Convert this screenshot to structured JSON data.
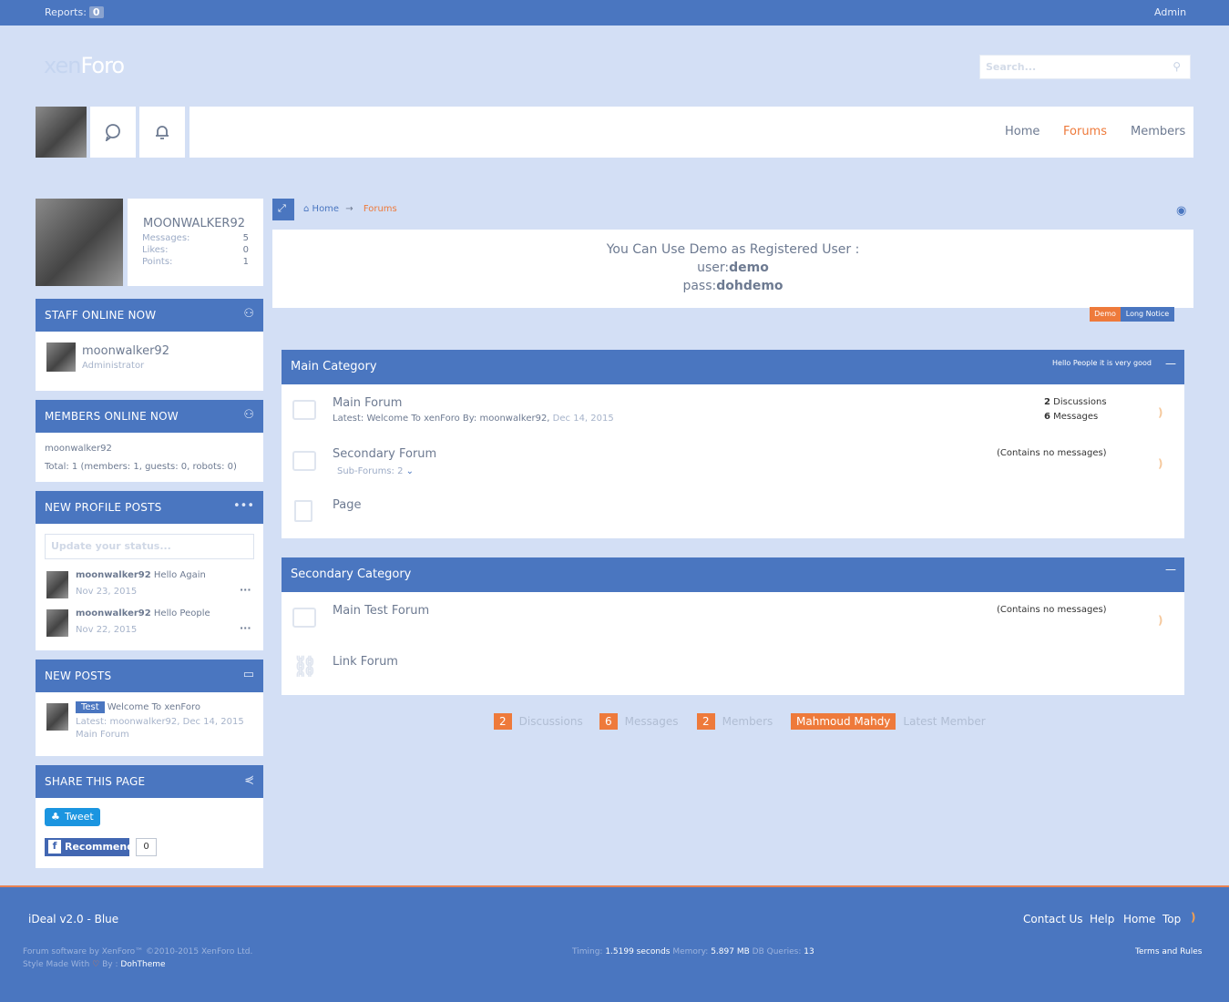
{
  "topbar": {
    "reports_label": "Reports:",
    "reports_count": "0",
    "admin": "Admin"
  },
  "logo": {
    "part1": "xen",
    "part2": "Foro"
  },
  "search": {
    "placeholder": "Search..."
  },
  "nav": {
    "home": "Home",
    "forums": "Forums",
    "members": "Members"
  },
  "profile": {
    "name": "MOONWALKER92",
    "messages_label": "Messages:",
    "messages": "5",
    "likes_label": "Likes:",
    "likes": "0",
    "points_label": "Points:",
    "points": "1"
  },
  "staff_online": {
    "title": "STAFF ONLINE NOW",
    "name": "moonwalker92",
    "role": "Administrator"
  },
  "members_online": {
    "title": "MEMBERS ONLINE NOW",
    "name": "moonwalker92",
    "total": "Total: 1 (members: 1, guests: 0, robots: 0)"
  },
  "profile_posts": {
    "title": "NEW PROFILE POSTS",
    "placeholder": "Update your status...",
    "posts": [
      {
        "user": "moonwalker92",
        "text": "Hello Again",
        "date": "Nov 23, 2015"
      },
      {
        "user": "moonwalker92",
        "text": "Hello People",
        "date": "Nov 22, 2015"
      }
    ]
  },
  "new_posts": {
    "title": "NEW POSTS",
    "prefix": "Test",
    "thread": "Welcome To xenForo",
    "latest": "Latest: moonwalker92, Dec 14, 2015",
    "forum": "Main Forum"
  },
  "share": {
    "title": "SHARE THIS PAGE",
    "tweet": "Tweet",
    "recommend": "Recommend",
    "count": "0"
  },
  "breadcrumb": {
    "home": "Home",
    "forums": "Forums"
  },
  "notice": {
    "line1": "You Can Use Demo as Registered User :",
    "user_label": "user:",
    "user": "demo",
    "pass_label": "pass:",
    "pass": "dohdemo",
    "tab1": "Demo",
    "tab2": "Long Notice"
  },
  "categories": [
    {
      "title": "Main Category",
      "desc": "Hello People it is very good",
      "forums": [
        {
          "name": "Main Forum",
          "latest": "Latest: Welcome To xenForo By: moonwalker92, ",
          "latest_date": "Dec 14, 2015",
          "discussions": "2",
          "discussions_label": "Discussions",
          "messages": "6",
          "messages_label": "Messages"
        },
        {
          "name": "Secondary Forum",
          "subforums": "Sub-Forums: 2",
          "empty": "(Contains no messages)"
        },
        {
          "name": "Page"
        }
      ]
    },
    {
      "title": "Secondary Category",
      "forums": [
        {
          "name": "Main Test Forum",
          "empty": "(Contains no messages)"
        },
        {
          "name": "Link Forum"
        }
      ]
    }
  ],
  "stats": {
    "discussions": "2",
    "discussions_label": "Discussions",
    "messages": "6",
    "messages_label": "Messages",
    "members": "2",
    "members_label": "Members",
    "latest_member": "Mahmoud Mahdy",
    "latest_member_label": "Latest Member"
  },
  "footer": {
    "style": "iDeal v2.0 - Blue",
    "contact": "Contact Us",
    "help": "Help",
    "home": "Home",
    "top": "Top",
    "copyright": "Forum software by XenForo™ ©2010-2015 XenForo Ltd.",
    "style_made": "Style Made With",
    "by": "By :",
    "author": "DohTheme",
    "timing_label": "Timing:",
    "timing": "1.5199 seconds",
    "memory_label": "Memory:",
    "memory": "5.897 MB",
    "db_label": "DB Queries:",
    "db": "13",
    "terms": "Terms and Rules"
  },
  "colors": {
    "accent": "#4a76c0",
    "orange": "#ee7a3b",
    "background": "#d3dff5"
  }
}
